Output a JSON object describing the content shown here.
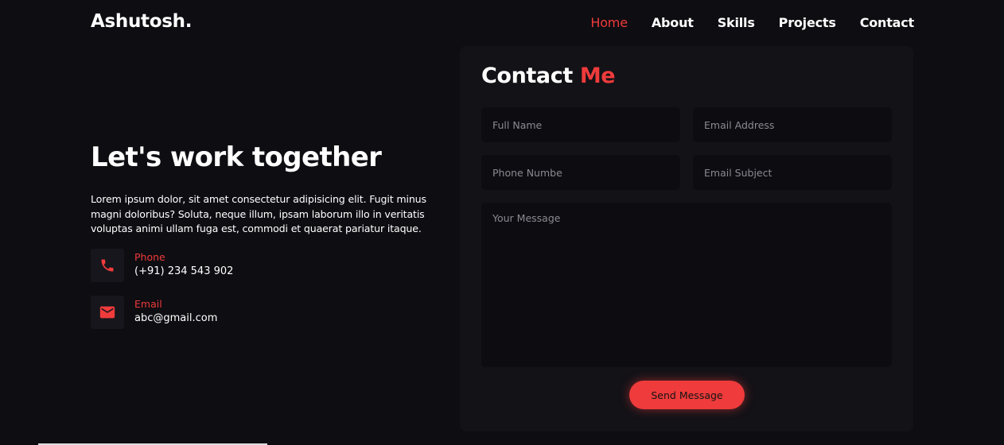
{
  "header": {
    "logo": "Ashutosh.",
    "nav": [
      {
        "label": "Home",
        "active": true
      },
      {
        "label": "About",
        "active": false
      },
      {
        "label": "Skills",
        "active": false
      },
      {
        "label": "Projects",
        "active": false
      },
      {
        "label": "Contact",
        "active": false
      }
    ]
  },
  "intro": {
    "headline": "Let's work together",
    "paragraph": "Lorem ipsum dolor, sit amet consectetur adipisicing elit. Fugit minus magni doloribus? Soluta, neque illum, ipsam laborum illo in veritatis voluptas animi ullam fuga est, commodi et quaerat pariatur itaque."
  },
  "contact_info": {
    "phone": {
      "label": "Phone",
      "value": "(+91) 234 543 902",
      "icon": "phone-icon"
    },
    "email": {
      "label": "Email",
      "value": "abc@gmail.com",
      "icon": "mail-icon"
    }
  },
  "form": {
    "title_main": "Contact",
    "title_accent": "Me",
    "full_name_placeholder": "Full Name",
    "email_placeholder": "Email Address",
    "phone_placeholder": "Phone Numbe",
    "subject_placeholder": "Email Subject",
    "message_placeholder": "Your Message",
    "submit_label": "Send Message"
  },
  "colors": {
    "background": "#0e0d12",
    "card": "#131217",
    "field": "#0d0c10",
    "accent": "#ef3b3b",
    "text": "#ffffff",
    "placeholder": "#8b8a91"
  }
}
